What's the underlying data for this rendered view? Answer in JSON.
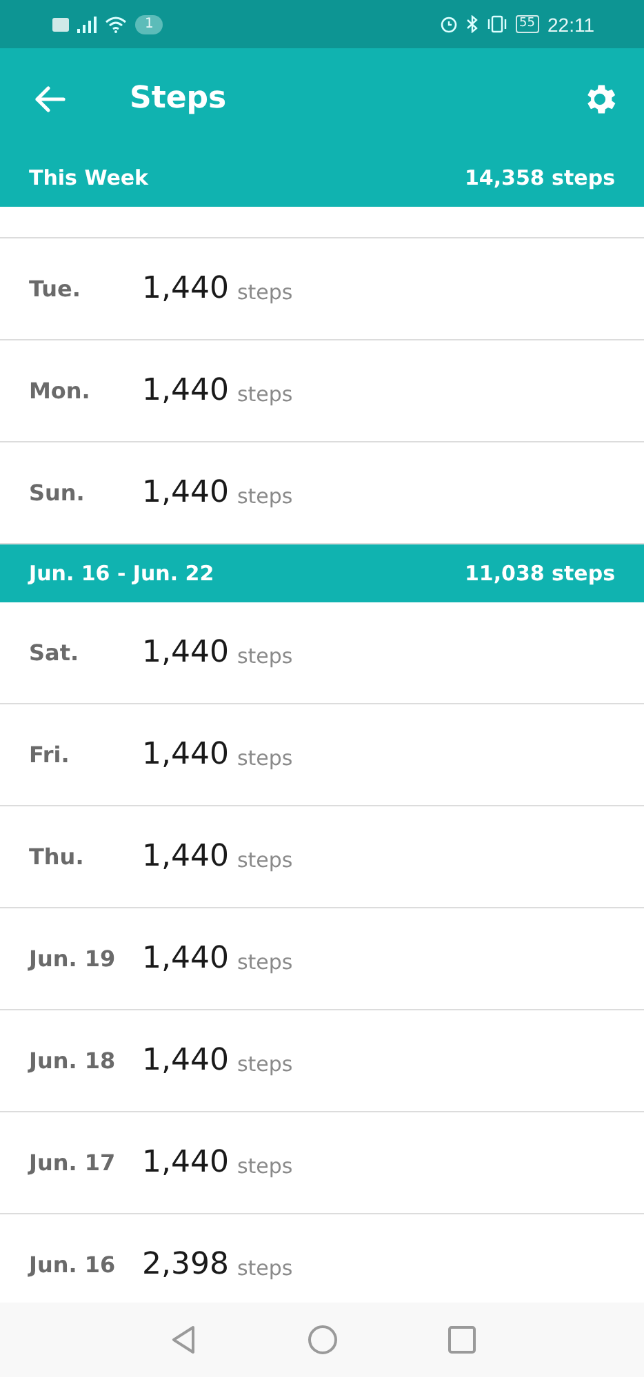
{
  "status_bar": {
    "notification_count": "1",
    "battery": "55",
    "time": "22:11"
  },
  "app_bar": {
    "title": "Steps"
  },
  "sections": [
    {
      "label": "This Week",
      "total": "14,358 steps",
      "days": [
        {
          "day": "Tue.",
          "count": "1,440",
          "unit": "steps"
        },
        {
          "day": "Mon.",
          "count": "1,440",
          "unit": "steps"
        },
        {
          "day": "Sun.",
          "count": "1,440",
          "unit": "steps"
        }
      ]
    },
    {
      "label": "Jun. 16 - Jun. 22",
      "total": "11,038 steps",
      "days": [
        {
          "day": "Sat.",
          "count": "1,440",
          "unit": "steps"
        },
        {
          "day": "Fri.",
          "count": "1,440",
          "unit": "steps"
        },
        {
          "day": "Thu.",
          "count": "1,440",
          "unit": "steps"
        },
        {
          "day": "Jun. 19",
          "count": "1,440",
          "unit": "steps"
        },
        {
          "day": "Jun. 18",
          "count": "1,440",
          "unit": "steps"
        },
        {
          "day": "Jun. 17",
          "count": "1,440",
          "unit": "steps"
        },
        {
          "day": "Jun. 16",
          "count": "2,398",
          "unit": "steps"
        }
      ]
    }
  ]
}
